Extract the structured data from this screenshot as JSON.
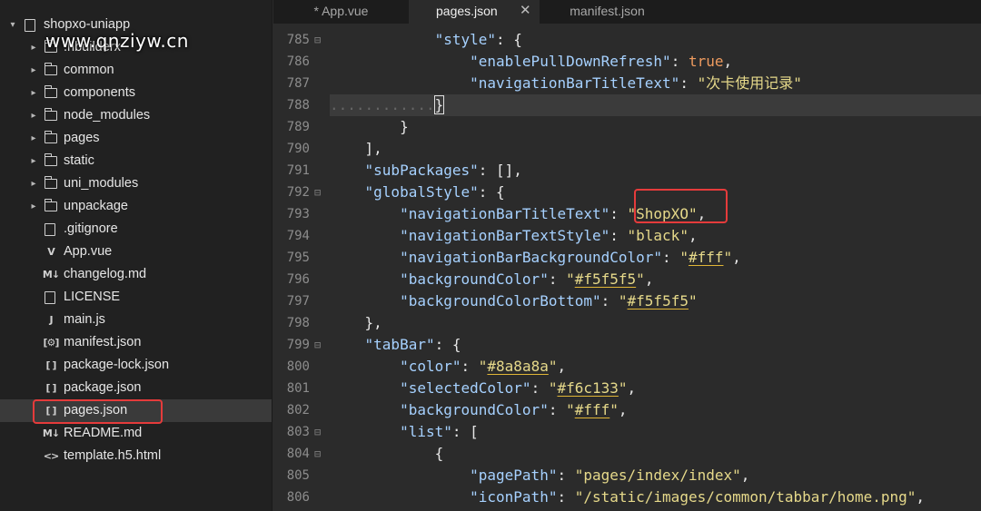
{
  "sidebar": {
    "project_name": "shopxo-uniapp",
    "watermark": "www.qnziyw.cn",
    "items": [
      {
        "label": ".hbuilderx",
        "type": "folder",
        "icon": "folder-icon"
      },
      {
        "label": "common",
        "type": "folder",
        "icon": "folder-icon"
      },
      {
        "label": "components",
        "type": "folder",
        "icon": "folder-icon"
      },
      {
        "label": "node_modules",
        "type": "folder",
        "icon": "folder-icon"
      },
      {
        "label": "pages",
        "type": "folder",
        "icon": "folder-icon"
      },
      {
        "label": "static",
        "type": "folder",
        "icon": "folder-icon"
      },
      {
        "label": "uni_modules",
        "type": "folder",
        "icon": "folder-icon"
      },
      {
        "label": "unpackage",
        "type": "folder",
        "icon": "folder-icon"
      },
      {
        "label": ".gitignore",
        "type": "file",
        "icon": "file-icon"
      },
      {
        "label": "App.vue",
        "type": "file",
        "icon": "vue-file-icon",
        "glyph": "V"
      },
      {
        "label": "changelog.md",
        "type": "file",
        "icon": "markdown-file-icon",
        "glyph": "M↓"
      },
      {
        "label": "LICENSE",
        "type": "file",
        "icon": "file-icon"
      },
      {
        "label": "main.js",
        "type": "file",
        "icon": "js-file-icon",
        "glyph": "J"
      },
      {
        "label": "manifest.json",
        "type": "file",
        "icon": "settings-file-icon",
        "glyph": "[⚙]"
      },
      {
        "label": "package-lock.json",
        "type": "file",
        "icon": "json-file-icon",
        "glyph": "[ ]"
      },
      {
        "label": "package.json",
        "type": "file",
        "icon": "json-file-icon",
        "glyph": "[ ]"
      },
      {
        "label": "pages.json",
        "type": "file",
        "icon": "json-file-icon",
        "glyph": "[ ]",
        "selected": true
      },
      {
        "label": "README.md",
        "type": "file",
        "icon": "markdown-file-icon",
        "glyph": "M↓"
      },
      {
        "label": "template.h5.html",
        "type": "file",
        "icon": "html-file-icon",
        "glyph": "<>"
      }
    ]
  },
  "tabs": [
    {
      "label": "* App.vue",
      "active": false
    },
    {
      "label": "pages.json",
      "active": true,
      "close": "✕"
    },
    {
      "label": "manifest.json",
      "active": false
    }
  ],
  "editor": {
    "lines": [
      {
        "n": "785",
        "fold": "⊟",
        "indent": "            ",
        "tokens": [
          {
            "t": "\"style\"",
            "c": "k"
          },
          {
            "t": ": {",
            "c": "p"
          }
        ]
      },
      {
        "n": "786",
        "fold": "",
        "indent": "                ",
        "tokens": [
          {
            "t": "\"enablePullDownRefresh\"",
            "c": "k"
          },
          {
            "t": ": ",
            "c": "p"
          },
          {
            "t": "true",
            "c": "b"
          },
          {
            "t": ",",
            "c": "p"
          }
        ]
      },
      {
        "n": "787",
        "fold": "",
        "indent": "                ",
        "tokens": [
          {
            "t": "\"navigationBarTitleText\"",
            "c": "k"
          },
          {
            "t": ": ",
            "c": "p"
          },
          {
            "t": "\"次卡使用记录\"",
            "c": "s"
          }
        ]
      },
      {
        "n": "788",
        "fold": "",
        "indent": "",
        "dots": "............",
        "current": true,
        "tokens": [
          {
            "t": "}",
            "c": "p",
            "box": true
          }
        ]
      },
      {
        "n": "789",
        "fold": "",
        "indent": "        ",
        "tokens": [
          {
            "t": "}",
            "c": "p"
          }
        ]
      },
      {
        "n": "790",
        "fold": "",
        "indent": "    ",
        "tokens": [
          {
            "t": "],",
            "c": "p"
          }
        ]
      },
      {
        "n": "791",
        "fold": "",
        "indent": "    ",
        "tokens": [
          {
            "t": "\"subPackages\"",
            "c": "k"
          },
          {
            "t": ": [],",
            "c": "p"
          }
        ]
      },
      {
        "n": "792",
        "fold": "⊟",
        "indent": "    ",
        "tokens": [
          {
            "t": "\"globalStyle\"",
            "c": "k"
          },
          {
            "t": ": {",
            "c": "p"
          }
        ]
      },
      {
        "n": "793",
        "fold": "",
        "indent": "        ",
        "tokens": [
          {
            "t": "\"navigationBarTitleText\"",
            "c": "k"
          },
          {
            "t": ": ",
            "c": "p"
          },
          {
            "t": "\"ShopXO\"",
            "c": "s"
          },
          {
            "t": ",",
            "c": "p"
          }
        ]
      },
      {
        "n": "794",
        "fold": "",
        "indent": "        ",
        "tokens": [
          {
            "t": "\"navigationBarTextStyle\"",
            "c": "k"
          },
          {
            "t": ": ",
            "c": "p"
          },
          {
            "t": "\"black\"",
            "c": "s"
          },
          {
            "t": ",",
            "c": "p"
          }
        ]
      },
      {
        "n": "795",
        "fold": "",
        "indent": "        ",
        "tokens": [
          {
            "t": "\"navigationBarBackgroundColor\"",
            "c": "k"
          },
          {
            "t": ": ",
            "c": "p"
          },
          {
            "t": "\"",
            "c": "s"
          },
          {
            "t": "#fff",
            "c": "s",
            "ul": true
          },
          {
            "t": "\"",
            "c": "s"
          },
          {
            "t": ",",
            "c": "p"
          }
        ]
      },
      {
        "n": "796",
        "fold": "",
        "indent": "        ",
        "tokens": [
          {
            "t": "\"backgroundColor\"",
            "c": "k"
          },
          {
            "t": ": ",
            "c": "p"
          },
          {
            "t": "\"",
            "c": "s"
          },
          {
            "t": "#f5f5f5",
            "c": "s",
            "ul": true
          },
          {
            "t": "\"",
            "c": "s"
          },
          {
            "t": ",",
            "c": "p"
          }
        ]
      },
      {
        "n": "797",
        "fold": "",
        "indent": "        ",
        "tokens": [
          {
            "t": "\"backgroundColorBottom\"",
            "c": "k"
          },
          {
            "t": ": ",
            "c": "p"
          },
          {
            "t": "\"",
            "c": "s"
          },
          {
            "t": "#f5f5f5",
            "c": "s",
            "ul": true
          },
          {
            "t": "\"",
            "c": "s"
          }
        ]
      },
      {
        "n": "798",
        "fold": "",
        "indent": "    ",
        "tokens": [
          {
            "t": "},",
            "c": "p"
          }
        ]
      },
      {
        "n": "799",
        "fold": "⊟",
        "indent": "    ",
        "tokens": [
          {
            "t": "\"tabBar\"",
            "c": "k"
          },
          {
            "t": ": {",
            "c": "p"
          }
        ]
      },
      {
        "n": "800",
        "fold": "",
        "indent": "        ",
        "tokens": [
          {
            "t": "\"color\"",
            "c": "k"
          },
          {
            "t": ": ",
            "c": "p"
          },
          {
            "t": "\"",
            "c": "s"
          },
          {
            "t": "#8a8a8a",
            "c": "s",
            "ul": true
          },
          {
            "t": "\"",
            "c": "s"
          },
          {
            "t": ",",
            "c": "p"
          }
        ]
      },
      {
        "n": "801",
        "fold": "",
        "indent": "        ",
        "tokens": [
          {
            "t": "\"selectedColor\"",
            "c": "k"
          },
          {
            "t": ": ",
            "c": "p"
          },
          {
            "t": "\"",
            "c": "s"
          },
          {
            "t": "#f6c133",
            "c": "s",
            "ul": true
          },
          {
            "t": "\"",
            "c": "s"
          },
          {
            "t": ",",
            "c": "p"
          }
        ]
      },
      {
        "n": "802",
        "fold": "",
        "indent": "        ",
        "tokens": [
          {
            "t": "\"backgroundColor\"",
            "c": "k"
          },
          {
            "t": ": ",
            "c": "p"
          },
          {
            "t": "\"",
            "c": "s"
          },
          {
            "t": "#fff",
            "c": "s",
            "ul": true
          },
          {
            "t": "\"",
            "c": "s"
          },
          {
            "t": ",",
            "c": "p"
          }
        ]
      },
      {
        "n": "803",
        "fold": "⊟",
        "indent": "        ",
        "tokens": [
          {
            "t": "\"list\"",
            "c": "k"
          },
          {
            "t": ": [",
            "c": "p"
          }
        ]
      },
      {
        "n": "804",
        "fold": "⊟",
        "indent": "            ",
        "tokens": [
          {
            "t": "{",
            "c": "p"
          }
        ]
      },
      {
        "n": "805",
        "fold": "",
        "indent": "                ",
        "tokens": [
          {
            "t": "\"pagePath\"",
            "c": "k"
          },
          {
            "t": ": ",
            "c": "p"
          },
          {
            "t": "\"pages/index/index\"",
            "c": "s"
          },
          {
            "t": ",",
            "c": "p"
          }
        ]
      },
      {
        "n": "806",
        "fold": "",
        "indent": "                ",
        "tokens": [
          {
            "t": "\"iconPath\"",
            "c": "k"
          },
          {
            "t": ": ",
            "c": "p"
          },
          {
            "t": "\"/static/images/common/tabbar/home.png\"",
            "c": "s"
          },
          {
            "t": ",",
            "c": "p"
          }
        ]
      }
    ]
  },
  "colors": {
    "key": "#a6d1ff",
    "string": "#e6d98a",
    "boolean": "#ee9b5f",
    "highlight": "#e53b3b"
  }
}
